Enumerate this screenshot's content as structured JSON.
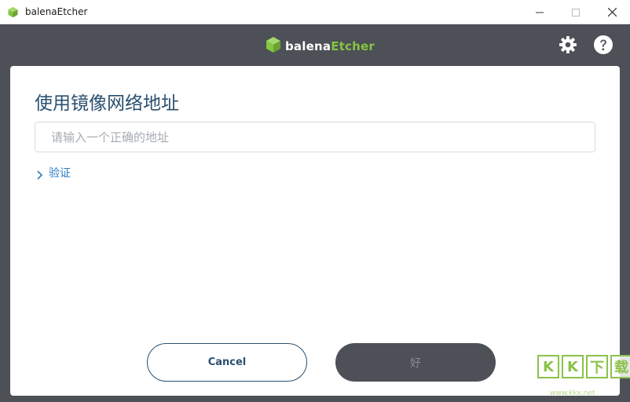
{
  "window": {
    "title": "balenaEtcher",
    "minimize_glyph": "—",
    "maximize_glyph": "☐",
    "close_glyph": "✕"
  },
  "brand": {
    "name_prefix": "balena",
    "name_accent": "Etcher",
    "accent_color": "#85c441"
  },
  "header": {
    "icons": [
      "gear-icon",
      "help-icon"
    ]
  },
  "dialog": {
    "heading": "使用镜像网络地址",
    "url_input": {
      "value": "",
      "placeholder": "请输入一个正确的地址"
    },
    "verify_label": "验证",
    "cancel_label": "Cancel",
    "ok_label": "好"
  },
  "watermark": {
    "chars": [
      "K",
      "K",
      "下",
      "载"
    ],
    "sub": "www.kkx.net"
  },
  "colors": {
    "header_bg": "#4d5057",
    "heading": "#2a506f",
    "link": "#2a7ec4",
    "ok_disabled_bg": "#4d5057"
  }
}
